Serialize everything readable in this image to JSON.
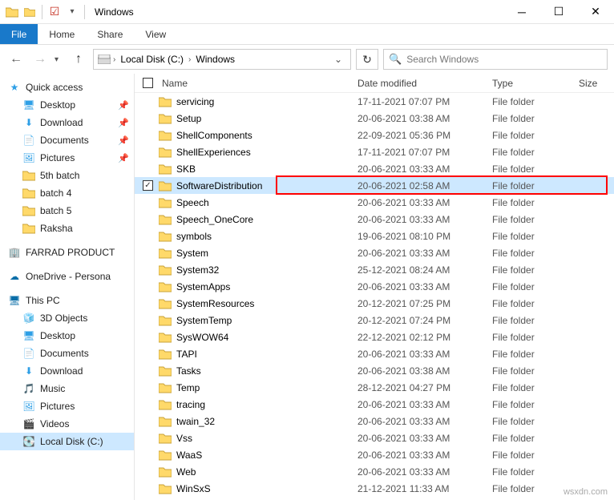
{
  "title": "Windows",
  "ribbon": {
    "file": "File",
    "tabs": [
      "Home",
      "Share",
      "View"
    ]
  },
  "address": {
    "segments": [
      "Local Disk (C:)",
      "Windows"
    ]
  },
  "search": {
    "placeholder": "Search Windows"
  },
  "sidebar": {
    "quick_access": "Quick access",
    "qa_items": [
      {
        "label": "Desktop",
        "pin": true
      },
      {
        "label": "Download",
        "pin": true
      },
      {
        "label": "Documents",
        "pin": true
      },
      {
        "label": "Pictures",
        "pin": true
      },
      {
        "label": "5th batch"
      },
      {
        "label": "batch 4"
      },
      {
        "label": "batch 5"
      },
      {
        "label": "Raksha"
      }
    ],
    "farrad": "FARRAD PRODUCT",
    "onedrive": "OneDrive - Persona",
    "this_pc": "This PC",
    "pc_items": [
      "3D Objects",
      "Desktop",
      "Documents",
      "Download",
      "Music",
      "Pictures",
      "Videos",
      "Local Disk (C:)"
    ]
  },
  "columns": {
    "name": "Name",
    "date": "Date modified",
    "type": "Type",
    "size": "Size"
  },
  "files": [
    {
      "name": "servicing",
      "date": "17-11-2021 07:07 PM",
      "type": "File folder"
    },
    {
      "name": "Setup",
      "date": "20-06-2021 03:38 AM",
      "type": "File folder"
    },
    {
      "name": "ShellComponents",
      "date": "22-09-2021 05:36 PM",
      "type": "File folder"
    },
    {
      "name": "ShellExperiences",
      "date": "17-11-2021 07:07 PM",
      "type": "File folder"
    },
    {
      "name": "SKB",
      "date": "20-06-2021 03:33 AM",
      "type": "File folder"
    },
    {
      "name": "SoftwareDistribution",
      "date": "20-06-2021 02:58 AM",
      "type": "File folder",
      "selected": true
    },
    {
      "name": "Speech",
      "date": "20-06-2021 03:33 AM",
      "type": "File folder"
    },
    {
      "name": "Speech_OneCore",
      "date": "20-06-2021 03:33 AM",
      "type": "File folder"
    },
    {
      "name": "symbols",
      "date": "19-06-2021 08:10 PM",
      "type": "File folder"
    },
    {
      "name": "System",
      "date": "20-06-2021 03:33 AM",
      "type": "File folder"
    },
    {
      "name": "System32",
      "date": "25-12-2021 08:24 AM",
      "type": "File folder"
    },
    {
      "name": "SystemApps",
      "date": "20-06-2021 03:33 AM",
      "type": "File folder"
    },
    {
      "name": "SystemResources",
      "date": "20-12-2021 07:25 PM",
      "type": "File folder"
    },
    {
      "name": "SystemTemp",
      "date": "20-12-2021 07:24 PM",
      "type": "File folder"
    },
    {
      "name": "SysWOW64",
      "date": "22-12-2021 02:12 PM",
      "type": "File folder"
    },
    {
      "name": "TAPI",
      "date": "20-06-2021 03:33 AM",
      "type": "File folder"
    },
    {
      "name": "Tasks",
      "date": "20-06-2021 03:38 AM",
      "type": "File folder"
    },
    {
      "name": "Temp",
      "date": "28-12-2021 04:27 PM",
      "type": "File folder"
    },
    {
      "name": "tracing",
      "date": "20-06-2021 03:33 AM",
      "type": "File folder"
    },
    {
      "name": "twain_32",
      "date": "20-06-2021 03:33 AM",
      "type": "File folder"
    },
    {
      "name": "Vss",
      "date": "20-06-2021 03:33 AM",
      "type": "File folder"
    },
    {
      "name": "WaaS",
      "date": "20-06-2021 03:33 AM",
      "type": "File folder"
    },
    {
      "name": "Web",
      "date": "20-06-2021 03:33 AM",
      "type": "File folder"
    },
    {
      "name": "WinSxS",
      "date": "21-12-2021 11:33 AM",
      "type": "File folder"
    }
  ],
  "watermark": "wsxdn.com"
}
